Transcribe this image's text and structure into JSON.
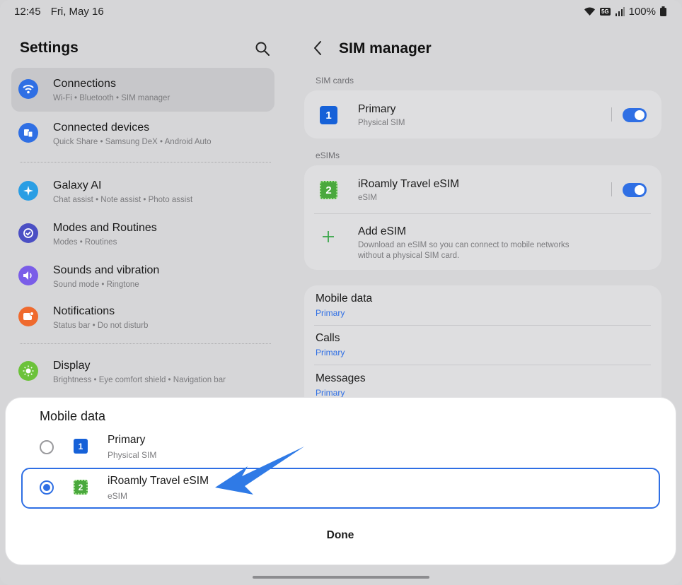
{
  "status_bar": {
    "time": "12:45",
    "date": "Fri, May 16",
    "network_badge": "5G",
    "battery": "100%"
  },
  "settings": {
    "title": "Settings",
    "items": [
      {
        "label": "Connections",
        "sub": "Wi-Fi  •  Bluetooth  •  SIM manager",
        "icon": "wifi-icon",
        "color": "#2f6fe4"
      },
      {
        "label": "Connected devices",
        "sub": "Quick Share  •  Samsung DeX  •  Android Auto",
        "icon": "connected-devices-icon",
        "color": "#2f6fe4"
      },
      {
        "label": "Galaxy AI",
        "sub": "Chat assist  •  Note assist  •  Photo assist",
        "icon": "galaxy-ai-icon",
        "color": "#2a9ee4"
      },
      {
        "label": "Modes and Routines",
        "sub": "Modes  •  Routines",
        "icon": "modes-icon",
        "color": "#4b4fc4"
      },
      {
        "label": "Sounds and vibration",
        "sub": "Sound mode  •  Ringtone",
        "icon": "sound-icon",
        "color": "#7a5de8"
      },
      {
        "label": "Notifications",
        "sub": "Status bar  •  Do not disturb",
        "icon": "notifications-icon",
        "color": "#ef6a2e"
      },
      {
        "label": "Display",
        "sub": "Brightness  •  Eye comfort shield  •  Navigation bar",
        "icon": "display-icon",
        "color": "#6cc23a"
      }
    ]
  },
  "sim_manager": {
    "title": "SIM manager",
    "sim_cards_label": "SIM cards",
    "esims_label": "eSIMs",
    "primary": {
      "badge": "1",
      "title": "Primary",
      "sub": "Physical SIM",
      "enabled": true
    },
    "esim": {
      "badge": "2",
      "title": "iRoamly Travel eSIM",
      "sub": "eSIM",
      "enabled": true
    },
    "add_esim": {
      "title": "Add eSIM",
      "sub": "Download an eSIM so you can connect to mobile networks without a physical SIM card."
    },
    "prefs": [
      {
        "title": "Mobile data",
        "value": "Primary"
      },
      {
        "title": "Calls",
        "value": "Primary"
      },
      {
        "title": "Messages",
        "value": "Primary"
      }
    ]
  },
  "sheet": {
    "title": "Mobile data",
    "options": [
      {
        "badge": "1",
        "title": "Primary",
        "sub": "Physical SIM",
        "selected": false
      },
      {
        "badge": "2",
        "title": "iRoamly Travel eSIM",
        "sub": "eSIM",
        "selected": true
      }
    ],
    "done_label": "Done"
  },
  "colors": {
    "accent": "#2f6fe4",
    "sim1_badge": "#1661d8",
    "sim2_badge": "#4aa83d",
    "arrow": "#2f6fe4"
  }
}
